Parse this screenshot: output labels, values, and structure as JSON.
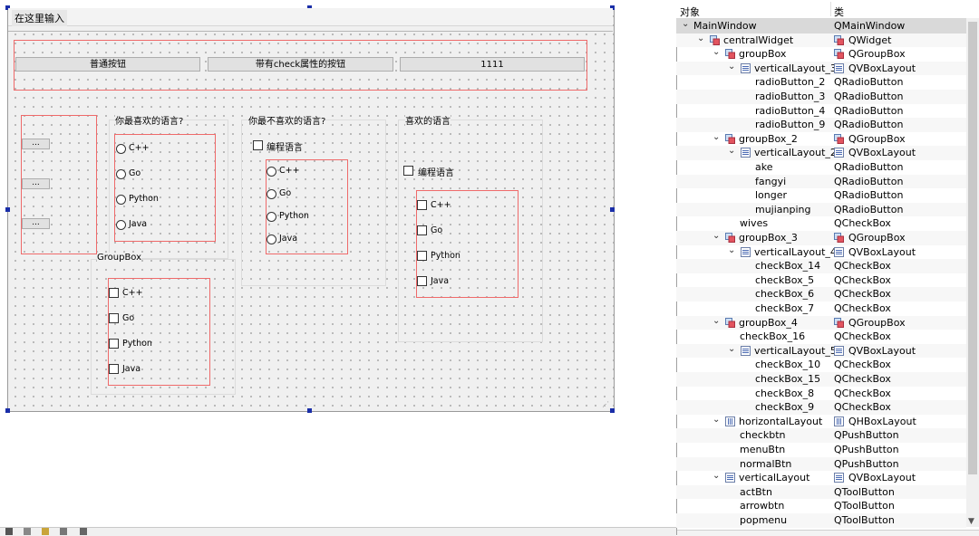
{
  "form": {
    "menu_placeholder": "在这里输入",
    "buttons": [
      "普通按钮",
      "带有check属性的按钮",
      "1111"
    ],
    "tool_buttons": [
      "...",
      "...",
      "..."
    ],
    "group_titles": {
      "fav": "你最喜欢的语言?",
      "dislike": "你最不喜欢的语言?",
      "like": "喜欢的语言",
      "generic": "GroupBox"
    },
    "checkbox_language_label": "编程语言",
    "languages": [
      "C++",
      "Go",
      "Python",
      "Java"
    ]
  },
  "inspector": {
    "header": {
      "object": "对象",
      "class": "类"
    },
    "rows": [
      {
        "name": "MainWindow",
        "cls": "QMainWindow",
        "level": 0,
        "arrow": "v",
        "icon": ""
      },
      {
        "name": "centralWidget",
        "cls": "QWidget",
        "level": 1,
        "arrow": "v",
        "icon": "widget"
      },
      {
        "name": "groupBox",
        "cls": "QGroupBox",
        "level": 2,
        "arrow": "v",
        "icon": "widget"
      },
      {
        "name": "verticalLayout_3",
        "cls": "QVBoxLayout",
        "level": 3,
        "arrow": "v",
        "icon": "vlayout"
      },
      {
        "name": "radioButton_2",
        "cls": "QRadioButton",
        "level": 4,
        "arrow": "",
        "icon": ""
      },
      {
        "name": "radioButton_3",
        "cls": "QRadioButton",
        "level": 4,
        "arrow": "",
        "icon": ""
      },
      {
        "name": "radioButton_4",
        "cls": "QRadioButton",
        "level": 4,
        "arrow": "",
        "icon": ""
      },
      {
        "name": "radioButton_9",
        "cls": "QRadioButton",
        "level": 4,
        "arrow": "",
        "icon": ""
      },
      {
        "name": "groupBox_2",
        "cls": "QGroupBox",
        "level": 2,
        "arrow": "v",
        "icon": "widget"
      },
      {
        "name": "verticalLayout_2",
        "cls": "QVBoxLayout",
        "level": 3,
        "arrow": "v",
        "icon": "vlayout"
      },
      {
        "name": "ake",
        "cls": "QRadioButton",
        "level": 4,
        "arrow": "",
        "icon": ""
      },
      {
        "name": "fangyi",
        "cls": "QRadioButton",
        "level": 4,
        "arrow": "",
        "icon": ""
      },
      {
        "name": "longer",
        "cls": "QRadioButton",
        "level": 4,
        "arrow": "",
        "icon": ""
      },
      {
        "name": "mujianping",
        "cls": "QRadioButton",
        "level": 4,
        "arrow": "",
        "icon": ""
      },
      {
        "name": "wives",
        "cls": "QCheckBox",
        "level": 3,
        "arrow": "",
        "icon": ""
      },
      {
        "name": "groupBox_3",
        "cls": "QGroupBox",
        "level": 2,
        "arrow": "v",
        "icon": "widget"
      },
      {
        "name": "verticalLayout_4",
        "cls": "QVBoxLayout",
        "level": 3,
        "arrow": "v",
        "icon": "vlayout"
      },
      {
        "name": "checkBox_14",
        "cls": "QCheckBox",
        "level": 4,
        "arrow": "",
        "icon": ""
      },
      {
        "name": "checkBox_5",
        "cls": "QCheckBox",
        "level": 4,
        "arrow": "",
        "icon": ""
      },
      {
        "name": "checkBox_6",
        "cls": "QCheckBox",
        "level": 4,
        "arrow": "",
        "icon": ""
      },
      {
        "name": "checkBox_7",
        "cls": "QCheckBox",
        "level": 4,
        "arrow": "",
        "icon": ""
      },
      {
        "name": "groupBox_4",
        "cls": "QGroupBox",
        "level": 2,
        "arrow": "v",
        "icon": "widget"
      },
      {
        "name": "checkBox_16",
        "cls": "QCheckBox",
        "level": 3,
        "arrow": "",
        "icon": ""
      },
      {
        "name": "verticalLayout_5",
        "cls": "QVBoxLayout",
        "level": 3,
        "arrow": "v",
        "icon": "vlayout"
      },
      {
        "name": "checkBox_10",
        "cls": "QCheckBox",
        "level": 4,
        "arrow": "",
        "icon": ""
      },
      {
        "name": "checkBox_15",
        "cls": "QCheckBox",
        "level": 4,
        "arrow": "",
        "icon": ""
      },
      {
        "name": "checkBox_8",
        "cls": "QCheckBox",
        "level": 4,
        "arrow": "",
        "icon": ""
      },
      {
        "name": "checkBox_9",
        "cls": "QCheckBox",
        "level": 4,
        "arrow": "",
        "icon": ""
      },
      {
        "name": "horizontalLayout",
        "cls": "QHBoxLayout",
        "level": 2,
        "arrow": "v",
        "icon": "hlayout"
      },
      {
        "name": "checkbtn",
        "cls": "QPushButton",
        "level": 3,
        "arrow": "",
        "icon": ""
      },
      {
        "name": "menuBtn",
        "cls": "QPushButton",
        "level": 3,
        "arrow": "",
        "icon": ""
      },
      {
        "name": "normalBtn",
        "cls": "QPushButton",
        "level": 3,
        "arrow": "",
        "icon": ""
      },
      {
        "name": "verticalLayout",
        "cls": "QVBoxLayout",
        "level": 2,
        "arrow": "v",
        "icon": "vlayout"
      },
      {
        "name": "actBtn",
        "cls": "QToolButton",
        "level": 3,
        "arrow": "",
        "icon": ""
      },
      {
        "name": "arrowbtn",
        "cls": "QToolButton",
        "level": 3,
        "arrow": "",
        "icon": ""
      },
      {
        "name": "popmenu",
        "cls": "QToolButton",
        "level": 3,
        "arrow": "",
        "icon": ""
      }
    ]
  },
  "colors": {
    "selection_red": "#ef6a6a",
    "handle_blue": "#1a2ea8",
    "selected_row": "#d9d9d9"
  }
}
